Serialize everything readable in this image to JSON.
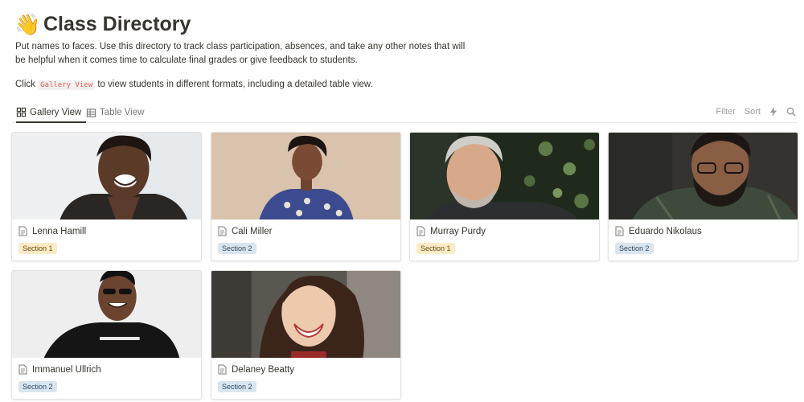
{
  "page": {
    "emoji": "👋",
    "title": "Class Directory",
    "description": "Put names to faces. Use this directory to track class participation, absences, and take any other notes that will be helpful when it comes time to calculate final grades or give feedback to students.",
    "click_prefix": "Click",
    "click_code": "Gallery View",
    "click_suffix": "to view students in different formats, including a detailed table view."
  },
  "tabs": [
    {
      "label": "Gallery View",
      "icon": "gallery-icon",
      "active": true
    },
    {
      "label": "Table View",
      "icon": "table-icon",
      "active": false
    }
  ],
  "actions": {
    "filter": "Filter",
    "sort": "Sort",
    "automation_icon": "lightning-icon",
    "search_icon": "search-icon"
  },
  "cards": [
    {
      "name": "Lenna Hamill",
      "section": "Section 1"
    },
    {
      "name": "Cali Miller",
      "section": "Section 2"
    },
    {
      "name": "Murray Purdy",
      "section": "Section 1"
    },
    {
      "name": "Eduardo Nikolaus",
      "section": "Section 2"
    },
    {
      "name": "Immanuel Ullrich",
      "section": "Section 2"
    },
    {
      "name": "Delaney Beatty",
      "section": "Section 2"
    }
  ],
  "colors": {
    "section1_bg": "#fbecc7",
    "section2_bg": "#d9e6f0",
    "code_text": "#eb5757"
  }
}
